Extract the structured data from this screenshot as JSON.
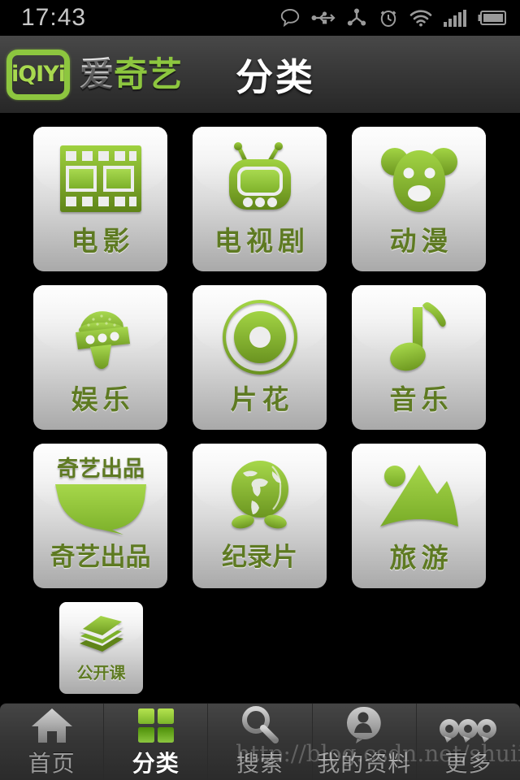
{
  "statusbar": {
    "time": "17:43",
    "icons": [
      {
        "name": "message-bubble-icon"
      },
      {
        "name": "usb-icon"
      },
      {
        "name": "share-network-icon"
      },
      {
        "name": "alarm-clock-icon"
      },
      {
        "name": "wifi-icon"
      },
      {
        "name": "signal-bars-icon"
      },
      {
        "name": "battery-icon"
      }
    ]
  },
  "header": {
    "logo_mark_text": "iQIYi",
    "logo_cn_first": "爱",
    "logo_cn_rest": "奇艺",
    "title": "分类"
  },
  "colors": {
    "brand_green": "#8dc63f",
    "label_green": "#5e7a22",
    "icon_green_light": "#9acd32",
    "icon_green_dark": "#6b8f1e",
    "header_dark": "#3a3a3a",
    "nav_dark": "#363636",
    "tile_top": "#fcfcfc",
    "tile_bottom": "#a9a9a9",
    "background": "#000000"
  },
  "grid": {
    "rows": [
      [
        {
          "label": "电影",
          "icon": "film-strip-icon",
          "tight": false
        },
        {
          "label": "电视剧",
          "icon": "television-icon",
          "tight": false
        },
        {
          "label": "动漫",
          "icon": "bear-face-icon",
          "tight": false
        }
      ],
      [
        {
          "label": "娱乐",
          "icon": "microphone-icon",
          "tight": false
        },
        {
          "label": "片花",
          "icon": "disc-icon",
          "tight": false
        },
        {
          "label": "音乐",
          "icon": "music-note-icon",
          "tight": false
        }
      ],
      [
        {
          "label": "奇艺出品",
          "icon": "speech-bubble-icon",
          "tight": true,
          "icon_text": "奇艺出品"
        },
        {
          "label": "纪录片",
          "icon": "globe-icon",
          "tight": true
        },
        {
          "label": "旅游",
          "icon": "mountain-icon",
          "tight": false
        }
      ],
      [
        {
          "label": "公开课",
          "icon": "books-stack-icon",
          "small": true
        }
      ]
    ]
  },
  "navbar": {
    "items": [
      {
        "label": "首页",
        "icon": "home-icon",
        "active": false
      },
      {
        "label": "分类",
        "icon": "grid-squares-icon",
        "active": true
      },
      {
        "label": "搜索",
        "icon": "search-icon",
        "active": false
      },
      {
        "label": "我的资料",
        "icon": "person-icon",
        "active": false
      },
      {
        "label": "更多",
        "icon": "more-dots-icon",
        "active": false
      }
    ]
  },
  "watermark": {
    "text": "http://blog.csdn.net/shuiiso"
  }
}
